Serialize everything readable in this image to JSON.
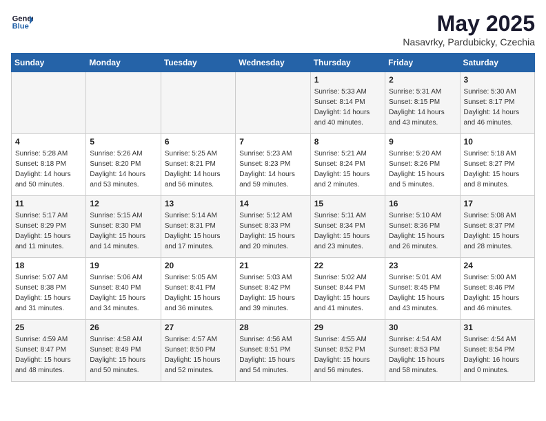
{
  "logo": {
    "line1": "General",
    "line2": "Blue"
  },
  "title": "May 2025",
  "subtitle": "Nasavrky, Pardubicky, Czechia",
  "weekdays": [
    "Sunday",
    "Monday",
    "Tuesday",
    "Wednesday",
    "Thursday",
    "Friday",
    "Saturday"
  ],
  "weeks": [
    [
      {
        "day": "",
        "info": ""
      },
      {
        "day": "",
        "info": ""
      },
      {
        "day": "",
        "info": ""
      },
      {
        "day": "",
        "info": ""
      },
      {
        "day": "1",
        "info": "Sunrise: 5:33 AM\nSunset: 8:14 PM\nDaylight: 14 hours\nand 40 minutes."
      },
      {
        "day": "2",
        "info": "Sunrise: 5:31 AM\nSunset: 8:15 PM\nDaylight: 14 hours\nand 43 minutes."
      },
      {
        "day": "3",
        "info": "Sunrise: 5:30 AM\nSunset: 8:17 PM\nDaylight: 14 hours\nand 46 minutes."
      }
    ],
    [
      {
        "day": "4",
        "info": "Sunrise: 5:28 AM\nSunset: 8:18 PM\nDaylight: 14 hours\nand 50 minutes."
      },
      {
        "day": "5",
        "info": "Sunrise: 5:26 AM\nSunset: 8:20 PM\nDaylight: 14 hours\nand 53 minutes."
      },
      {
        "day": "6",
        "info": "Sunrise: 5:25 AM\nSunset: 8:21 PM\nDaylight: 14 hours\nand 56 minutes."
      },
      {
        "day": "7",
        "info": "Sunrise: 5:23 AM\nSunset: 8:23 PM\nDaylight: 14 hours\nand 59 minutes."
      },
      {
        "day": "8",
        "info": "Sunrise: 5:21 AM\nSunset: 8:24 PM\nDaylight: 15 hours\nand 2 minutes."
      },
      {
        "day": "9",
        "info": "Sunrise: 5:20 AM\nSunset: 8:26 PM\nDaylight: 15 hours\nand 5 minutes."
      },
      {
        "day": "10",
        "info": "Sunrise: 5:18 AM\nSunset: 8:27 PM\nDaylight: 15 hours\nand 8 minutes."
      }
    ],
    [
      {
        "day": "11",
        "info": "Sunrise: 5:17 AM\nSunset: 8:29 PM\nDaylight: 15 hours\nand 11 minutes."
      },
      {
        "day": "12",
        "info": "Sunrise: 5:15 AM\nSunset: 8:30 PM\nDaylight: 15 hours\nand 14 minutes."
      },
      {
        "day": "13",
        "info": "Sunrise: 5:14 AM\nSunset: 8:31 PM\nDaylight: 15 hours\nand 17 minutes."
      },
      {
        "day": "14",
        "info": "Sunrise: 5:12 AM\nSunset: 8:33 PM\nDaylight: 15 hours\nand 20 minutes."
      },
      {
        "day": "15",
        "info": "Sunrise: 5:11 AM\nSunset: 8:34 PM\nDaylight: 15 hours\nand 23 minutes."
      },
      {
        "day": "16",
        "info": "Sunrise: 5:10 AM\nSunset: 8:36 PM\nDaylight: 15 hours\nand 26 minutes."
      },
      {
        "day": "17",
        "info": "Sunrise: 5:08 AM\nSunset: 8:37 PM\nDaylight: 15 hours\nand 28 minutes."
      }
    ],
    [
      {
        "day": "18",
        "info": "Sunrise: 5:07 AM\nSunset: 8:38 PM\nDaylight: 15 hours\nand 31 minutes."
      },
      {
        "day": "19",
        "info": "Sunrise: 5:06 AM\nSunset: 8:40 PM\nDaylight: 15 hours\nand 34 minutes."
      },
      {
        "day": "20",
        "info": "Sunrise: 5:05 AM\nSunset: 8:41 PM\nDaylight: 15 hours\nand 36 minutes."
      },
      {
        "day": "21",
        "info": "Sunrise: 5:03 AM\nSunset: 8:42 PM\nDaylight: 15 hours\nand 39 minutes."
      },
      {
        "day": "22",
        "info": "Sunrise: 5:02 AM\nSunset: 8:44 PM\nDaylight: 15 hours\nand 41 minutes."
      },
      {
        "day": "23",
        "info": "Sunrise: 5:01 AM\nSunset: 8:45 PM\nDaylight: 15 hours\nand 43 minutes."
      },
      {
        "day": "24",
        "info": "Sunrise: 5:00 AM\nSunset: 8:46 PM\nDaylight: 15 hours\nand 46 minutes."
      }
    ],
    [
      {
        "day": "25",
        "info": "Sunrise: 4:59 AM\nSunset: 8:47 PM\nDaylight: 15 hours\nand 48 minutes."
      },
      {
        "day": "26",
        "info": "Sunrise: 4:58 AM\nSunset: 8:49 PM\nDaylight: 15 hours\nand 50 minutes."
      },
      {
        "day": "27",
        "info": "Sunrise: 4:57 AM\nSunset: 8:50 PM\nDaylight: 15 hours\nand 52 minutes."
      },
      {
        "day": "28",
        "info": "Sunrise: 4:56 AM\nSunset: 8:51 PM\nDaylight: 15 hours\nand 54 minutes."
      },
      {
        "day": "29",
        "info": "Sunrise: 4:55 AM\nSunset: 8:52 PM\nDaylight: 15 hours\nand 56 minutes."
      },
      {
        "day": "30",
        "info": "Sunrise: 4:54 AM\nSunset: 8:53 PM\nDaylight: 15 hours\nand 58 minutes."
      },
      {
        "day": "31",
        "info": "Sunrise: 4:54 AM\nSunset: 8:54 PM\nDaylight: 16 hours\nand 0 minutes."
      }
    ]
  ]
}
